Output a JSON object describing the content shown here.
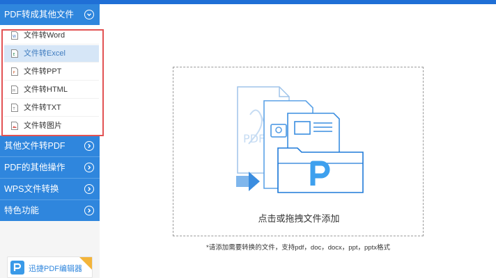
{
  "sidebar": {
    "categories": [
      {
        "label": "PDF转成其他文件"
      },
      {
        "label": "其他文件转PDF"
      },
      {
        "label": "PDF的其他操作"
      },
      {
        "label": "WPS文件转换"
      },
      {
        "label": "特色功能"
      }
    ],
    "sub_items": [
      {
        "label": "文件转Word",
        "icon": "word-file-icon"
      },
      {
        "label": "文件转Excel",
        "icon": "excel-file-icon"
      },
      {
        "label": "文件转PPT",
        "icon": "ppt-file-icon"
      },
      {
        "label": "文件转HTML",
        "icon": "html-file-icon"
      },
      {
        "label": "文件转TXT",
        "icon": "txt-file-icon"
      },
      {
        "label": "文件转图片",
        "icon": "image-file-icon"
      }
    ],
    "selected_sub_item": "文件转Excel",
    "app_badge": {
      "name": "迅捷PDF编辑器"
    }
  },
  "main": {
    "drop_zone_label": "点击或拖拽文件添加",
    "hint": "*请添加需要转换的文件，支持pdf，doc，docx，ppt，pptx格式",
    "art_text": "PDF"
  },
  "colors": {
    "accent": "#2f86dd",
    "highlight_border": "#e25253",
    "selected_bg": "#d6e6f7"
  }
}
